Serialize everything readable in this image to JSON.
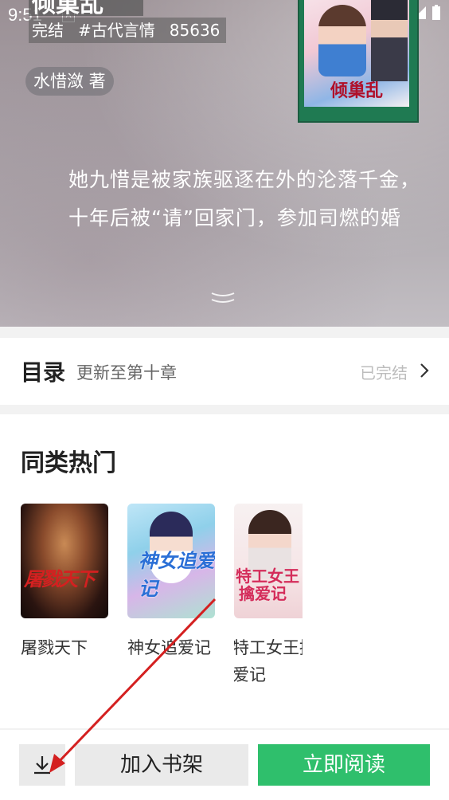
{
  "status_bar": {
    "time": "9:51",
    "notification_glyph": "A"
  },
  "book": {
    "title": "倾巢乱",
    "status": "完结",
    "tag": "#古代言情",
    "word_count": "85636",
    "author": "水惜潋 著",
    "cover_title": "倾巢乱",
    "synopsis_line1": "她九惜是被家族驱逐在外的沦落千金，",
    "synopsis_line2": "十年后被“请”回家门，参加司燃的婚"
  },
  "catalog": {
    "label": "目录",
    "update": "更新至第十章",
    "status": "已完结"
  },
  "similar": {
    "heading": "同类热门",
    "books": [
      {
        "title": "屠戮天下",
        "cover_text": "屠戮天下"
      },
      {
        "title": "神女追爱记",
        "cover_text": "神女追爱记"
      },
      {
        "title": "特工女王擒爱记",
        "cover_text_l1": "特工女王",
        "cover_text_l2": "擒爱记",
        "title_l1": "特工女王擒",
        "title_l2": "爱记"
      }
    ]
  },
  "bottom_bar": {
    "download_icon": "download-icon",
    "add_shelf": "加入书架",
    "read_now": "立即阅读"
  },
  "colors": {
    "accent_green": "#2fbf6c",
    "annotation_arrow": "#d42020"
  }
}
